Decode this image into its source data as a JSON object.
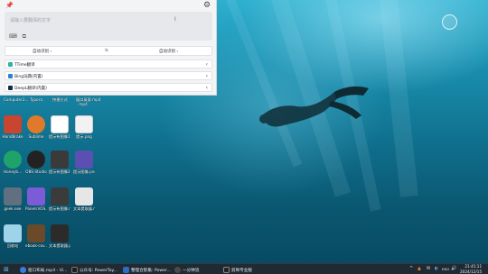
{
  "translator": {
    "placeholder": "请输入要翻译的文字",
    "caret": "I",
    "tools": [
      "⌨",
      "⧉"
    ],
    "source_lang": "自动识别",
    "target_lang": "自动识别",
    "swap": "⇆",
    "engines": [
      {
        "name": "TTime翻译",
        "icon_color": "#2bb3a3"
      },
      {
        "name": "Bing词典(内置)",
        "icon_color": "#2a7de1"
      },
      {
        "name": "DeepL翻译(内置)",
        "icon_color": "#0f2b46"
      }
    ]
  },
  "desktop": {
    "top_labels": [
      "Computer2...",
      "Typora",
      "快捷方式",
      "窗口录屏.mp4"
    ],
    "icons": [
      {
        "label": "HandBrake",
        "color": "#c8452f"
      },
      {
        "label": "Sublime",
        "color": "#e07a2a"
      },
      {
        "label": "提示有图像1.png",
        "color": "#ffffff"
      },
      {
        "label": "提示.png",
        "color": "#f2f2f2"
      },
      {
        "label": "Honeyb...",
        "color": "#1fa36b"
      },
      {
        "label": "OBS Studio",
        "color": "#222222"
      },
      {
        "label": "提示有图像2.png",
        "color": "#3a3a3a"
      },
      {
        "label": "提示图像.png",
        "color": "#5b4fb2"
      },
      {
        "label": "geek.exe",
        "color": "#607080"
      },
      {
        "label": "PanelsVOS...",
        "color": "#7b5cd6"
      },
      {
        "label": "提示有图像.mp4",
        "color": "#3b3b3b"
      },
      {
        "label": "文本提取器.mp4",
        "color": "#e6e6e6"
      },
      {
        "label": "回收站",
        "color": "#9fd3ea"
      },
      {
        "label": "ebook-cov...",
        "color": "#6b4a2a"
      },
      {
        "label": "文本提取器.png",
        "color": "#2b2b2b"
      }
    ]
  },
  "taskbar": {
    "buttons": [
      {
        "label": "窗口布局.mp4 - Vi...",
        "color": "#3c7be0"
      },
      {
        "label": "公众号: PowerToy...",
        "color": "#1d1d1d"
      },
      {
        "label": "整理合影集: Power...",
        "color": "#2d6cc0"
      },
      {
        "label": "一分钟流",
        "color": "#4a4a4a"
      },
      {
        "label": "剪映专业版",
        "color": "#222222"
      }
    ],
    "tray_icons": [
      "^",
      "▲",
      "✉",
      "◐",
      "ENG",
      "🔊"
    ],
    "time": "21:41:11",
    "date": "2024/12/15"
  }
}
